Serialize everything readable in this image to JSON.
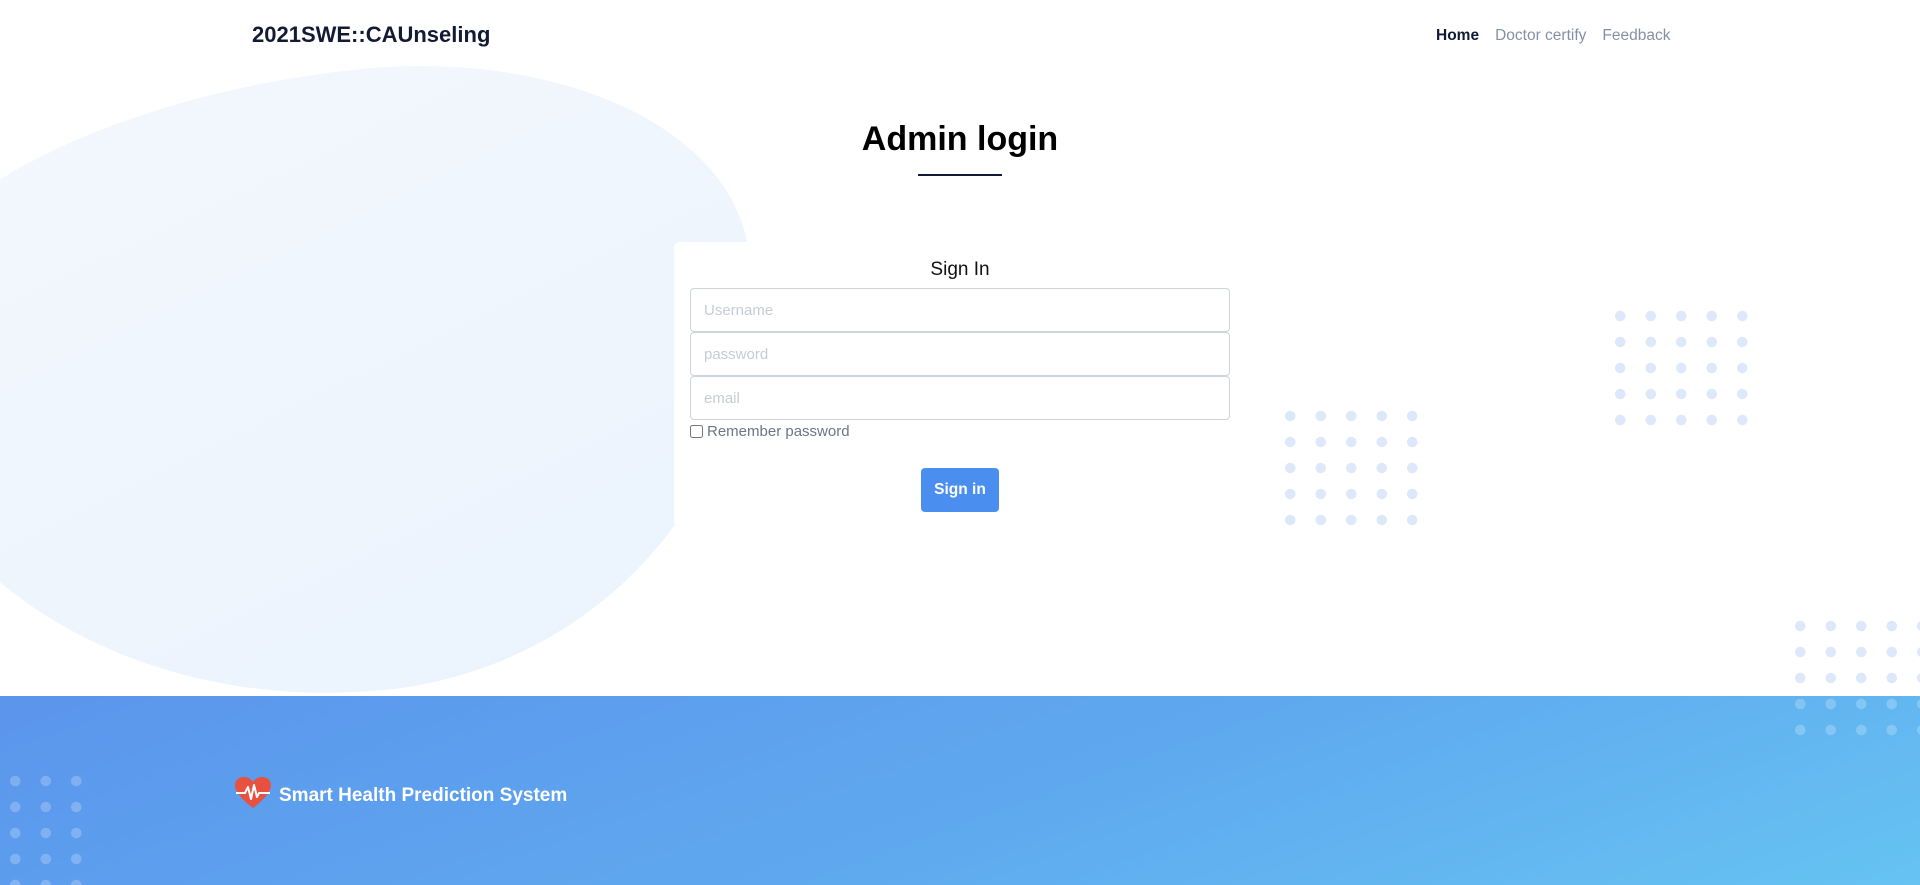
{
  "header": {
    "brand": "2021SWE::CAUnseling",
    "nav": [
      {
        "label": "Home",
        "active": true
      },
      {
        "label": "Doctor certify",
        "active": false
      },
      {
        "label": "Feedback",
        "active": false
      }
    ]
  },
  "page": {
    "title": "Admin login"
  },
  "form": {
    "heading": "Sign In",
    "username_placeholder": "Username",
    "password_placeholder": "password",
    "email_placeholder": "email",
    "remember_label": "Remember password",
    "remember_checked": false,
    "submit_label": "Sign in"
  },
  "footer": {
    "logo_icon": "heart-pulse-icon",
    "logo_text": "Smart Health Prediction System"
  },
  "colors": {
    "primary": "#4a8ff0",
    "brand_text": "#111b33",
    "footer_start": "#5b95ec",
    "footer_end": "#66c3f2",
    "heart": "#e8513f"
  }
}
